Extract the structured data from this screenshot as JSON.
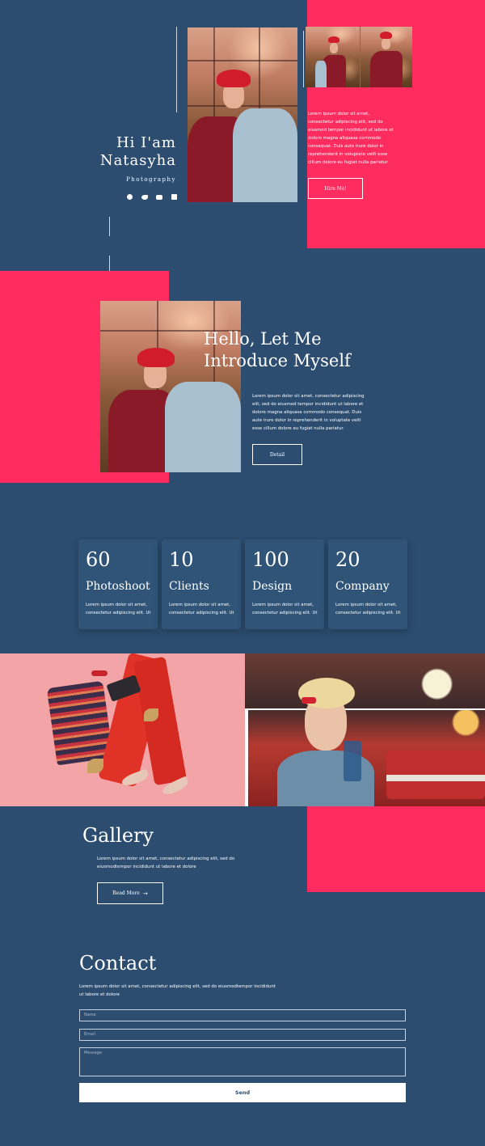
{
  "hero": {
    "greeting": "Hi I'am",
    "name": "Natasyha",
    "role": "Photography",
    "social_icons": [
      "facebook-icon",
      "twitter-icon",
      "youtube-icon",
      "linkedin-icon"
    ],
    "intro_text": "Lorem ipsum dolor sit amet, consectetur adipiscing elit, sed do eiusmod tempor incididunt ut labore et dolore magna aliquasa commodo consequat. Duis aute irure dolor in reprehenderit in voluptate velit esse cillum dolore eu fugiat nulla pariatur.",
    "hire_button": "Hire Me!"
  },
  "about": {
    "title_line1": "Hello, Let Me",
    "title_line2": "Introduce Myself",
    "text": "Lorem ipsum dolor sit amet, consectetur adipiscing elit, sed do eiusmod tempor incididunt ut labore et dolore magna aliquasa commodo consequat. Duis aute irure dolor in reprehenderit in voluptate velit esse cillum dolore eu fugiat nulla pariatur.",
    "detail_button": "Detail"
  },
  "stats": [
    {
      "number": "60",
      "label": "Photoshoot",
      "text": "Lorem ipsum dolor sit amet, consectetur adipiscing elit. Ut"
    },
    {
      "number": "10",
      "label": "Clients",
      "text": "Lorem ipsum dolor sit amet, consectetur adipiscing elit. Ut"
    },
    {
      "number": "100",
      "label": "Design",
      "text": "Lorem ipsum dolor sit amet, consectetur adipiscing elit. Ut"
    },
    {
      "number": "20",
      "label": "Company",
      "text": "Lorem ipsum dolor sit amet, consectetur adipiscing elit. Ut"
    }
  ],
  "gallery": {
    "title": "Gallery",
    "text": "Lorem ipsum dolor sit amet, consectetur adipiscing elit, sed do eiusmodtempor incididunt ut labore et dolore",
    "read_more": "Read More",
    "read_more_icon": "arrow-right-icon"
  },
  "contact": {
    "title": "Contact",
    "text": "Lorem ipsum dolor sit amet, consectetur adipiscing elit, sed do eiusmodtempor incididunt ut labore et dolore",
    "name_placeholder": "Name",
    "email_placeholder": "Email",
    "message_placeholder": "Message",
    "send_button": "Send"
  },
  "colors": {
    "background": "#2c4d70",
    "accent": "#ff2d5f",
    "card": "#2f5478"
  }
}
